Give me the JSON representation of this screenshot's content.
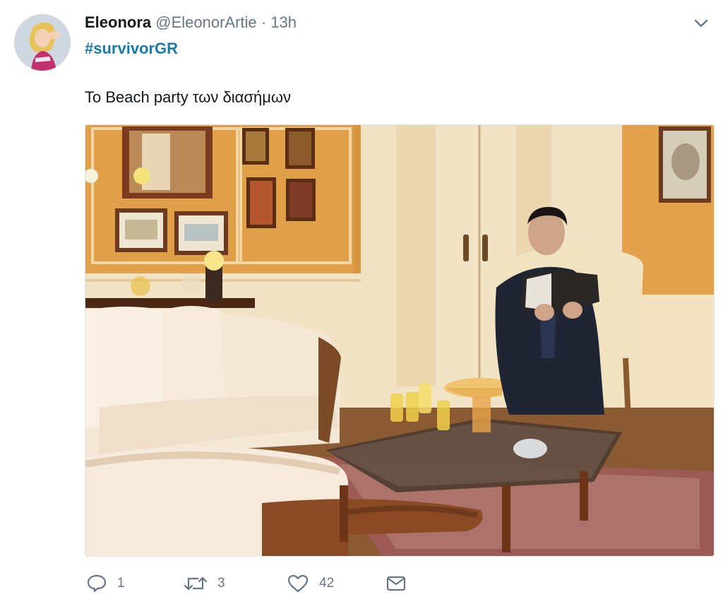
{
  "tweet": {
    "display_name": "Eleonora",
    "handle": "@EleonorArtie",
    "separator": "·",
    "timestamp": "13h",
    "hashtag": "#survivorGR",
    "text": "To Beach party των διασήμων",
    "avatar_icon": "user-avatar"
  },
  "actions": {
    "reply": {
      "icon": "reply-icon",
      "count": "1"
    },
    "retweet": {
      "icon": "retweet-icon",
      "count": "3"
    },
    "like": {
      "icon": "heart-icon",
      "count": "42"
    },
    "message": {
      "icon": "envelope-icon"
    }
  },
  "colors": {
    "text": "#14171a",
    "secondary": "#657786",
    "hashtag": "#1b7aa8",
    "border": "#e1e8ed"
  }
}
